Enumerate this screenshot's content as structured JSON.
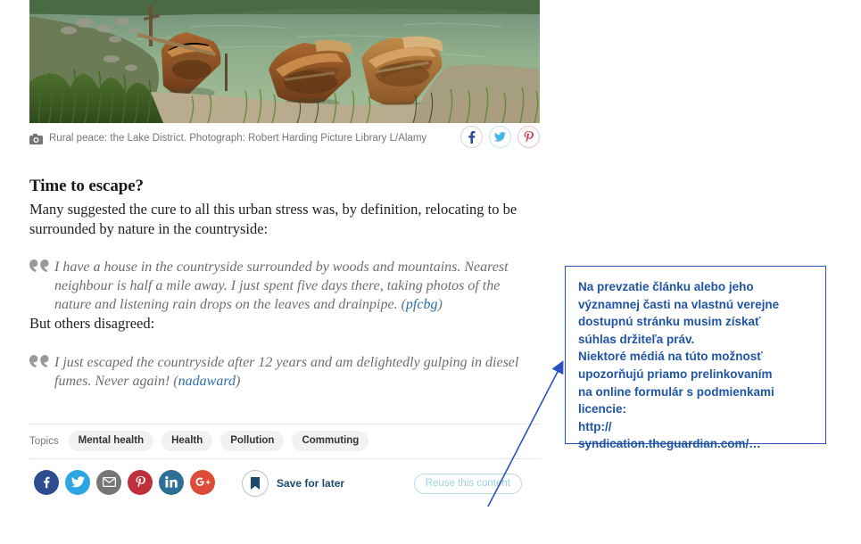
{
  "image": {
    "alt": "Three wooden rowing boats moored at the grassy shore of a lake",
    "camera_icon": "camera-icon"
  },
  "caption": {
    "text": "Rural peace: the Lake District. Photograph: Robert Harding Picture Library L/Alamy",
    "share_buttons": [
      {
        "name": "facebook-icon",
        "label": "f",
        "color": "#2e4d8f"
      },
      {
        "name": "twitter-icon",
        "label": "t",
        "color": "#41b7e6"
      },
      {
        "name": "pinterest-icon",
        "label": "p",
        "color": "#c8414c"
      }
    ]
  },
  "article": {
    "subhead": "Time to escape?",
    "intro": "Many suggested the cure to all this urban stress was, by definition, relocating to be surrounded by nature in the countryside:",
    "quote_one": {
      "text": "I have a house in the countryside surrounded by woods and mountains. Nearest neighbour is half a mile away. I just spent five days there, taking photos of the nature and listening rain drops on the leaves and drainpipe. (",
      "author": "pfcbg",
      "suffix": ")"
    },
    "transition": "But others disagreed:",
    "quote_two": {
      "text": "I just escaped the countryside after 12 years and am delightedly gulping in diesel fumes. Never again! (",
      "author": "nadaward",
      "suffix": ")"
    }
  },
  "topics": {
    "label": "Topics",
    "tags": [
      "Mental health",
      "Health",
      "Pollution",
      "Commuting"
    ]
  },
  "share": {
    "buttons": [
      {
        "name": "facebook-share-button",
        "color": "#2e4d8f"
      },
      {
        "name": "twitter-share-button",
        "color": "#2ba6e0"
      },
      {
        "name": "email-share-button",
        "color": "#767676"
      },
      {
        "name": "pinterest-share-button",
        "color": "#c0303c"
      },
      {
        "name": "linkedin-share-button",
        "color": "#2d6f96"
      },
      {
        "name": "googleplus-share-button",
        "color": "#dd4b39"
      }
    ],
    "save_label": "Save for later",
    "save_icon": "bookmark-icon",
    "reuse_label": "Reuse this content"
  },
  "callout": {
    "border_color": "#2a52be",
    "text_color": "#1f55a5",
    "lines": [
      "Na prevzatie článku alebo jeho",
      "významnej časti na vlastnú verejne",
      "dostupnú stránku musim získať",
      "súhlas držiteľa práv.",
      "Niektoré médiá na túto možnosť",
      "upozorňujú priamo prelinkovaním",
      "na online formulár s podmienkami",
      "licencie:",
      "http://",
      "syndication.theguardian.com/…"
    ]
  }
}
